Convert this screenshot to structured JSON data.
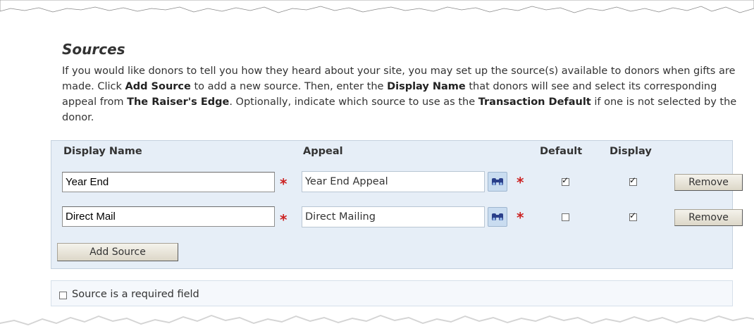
{
  "section": {
    "title": "Sources",
    "description": [
      {
        "text": "If you would like donors to tell you how they heard about your site, you may set up the source(s) available to donors when gifts are made.  Click ",
        "bold": false
      },
      {
        "text": "Add Source",
        "bold": true
      },
      {
        "text": " to add a new source.  Then, enter the ",
        "bold": false
      },
      {
        "text": "Display Name",
        "bold": true
      },
      {
        "text": " that donors will see and select its corresponding appeal from ",
        "bold": false
      },
      {
        "text": "The Raiser's Edge",
        "bold": true
      },
      {
        "text": ".  Optionally, indicate which source to use as the ",
        "bold": false
      },
      {
        "text": "Transaction Default",
        "bold": true
      },
      {
        "text": " if one is not selected by the donor.",
        "bold": false
      }
    ]
  },
  "table": {
    "headers": {
      "display_name": "Display Name",
      "appeal": "Appeal",
      "default": "Default",
      "display": "Display"
    },
    "rows": [
      {
        "display_name": "Year End",
        "appeal": "Year End Appeal",
        "default_checked": true,
        "display_checked": true,
        "remove_label": "Remove"
      },
      {
        "display_name": "Direct Mail",
        "appeal": "Direct Mailing",
        "default_checked": false,
        "display_checked": true,
        "remove_label": "Remove"
      }
    ],
    "required_marker": "*",
    "add_button_label": "Add Source"
  },
  "required_option": {
    "label": "Source is a required field",
    "checked": false
  },
  "icons": {
    "lookup": "binoculars-icon",
    "required": "asterisk-icon"
  },
  "colors": {
    "panel_background": "#e6eef7",
    "required_asterisk": "#cc2222",
    "lookup_button": "#c9dcf0"
  }
}
